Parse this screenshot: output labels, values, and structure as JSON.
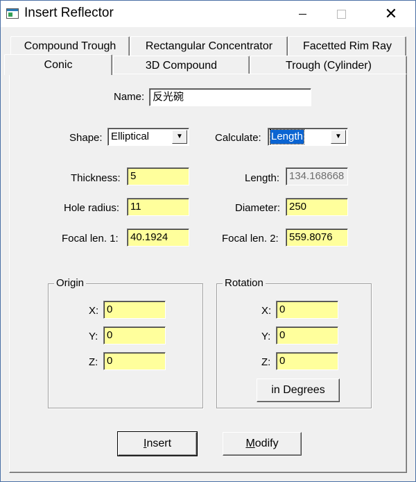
{
  "window": {
    "title": "Insert Reflector",
    "minimize": "—",
    "maximize": "☐",
    "close": "✕"
  },
  "tabs": {
    "row1": [
      "Compound Trough",
      "Rectangular Concentrator",
      "Facetted Rim Ray"
    ],
    "row2": [
      "Conic",
      "3D Compound",
      "Trough (Cylinder)"
    ],
    "active": "Conic"
  },
  "form": {
    "name": {
      "label": "Name:",
      "value": "反光碗"
    },
    "shape": {
      "label": "Shape:",
      "value": "Elliptical"
    },
    "calculate": {
      "label": "Calculate:",
      "value": "Length"
    },
    "thickness": {
      "label": "Thickness:",
      "value": "5"
    },
    "length": {
      "label": "Length:",
      "value": "134.168668"
    },
    "hole_radius": {
      "label": "Hole radius:",
      "value": "11"
    },
    "diameter": {
      "label": "Diameter:",
      "value": "250"
    },
    "focal1": {
      "label": "Focal len. 1:",
      "value": "40.1924"
    },
    "focal2": {
      "label": "Focal len. 2:",
      "value": "559.8076"
    }
  },
  "origin": {
    "title": "Origin",
    "x": {
      "label": "X:",
      "value": "0"
    },
    "y": {
      "label": "Y:",
      "value": "0"
    },
    "z": {
      "label": "Z:",
      "value": "0"
    }
  },
  "rotation": {
    "title": "Rotation",
    "x": {
      "label": "X:",
      "value": "0"
    },
    "y": {
      "label": "Y:",
      "value": "0"
    },
    "z": {
      "label": "Z:",
      "value": "0"
    },
    "degrees_button": "in Degrees"
  },
  "buttons": {
    "insert": {
      "mnemonic": "I",
      "rest": "nsert"
    },
    "modify": {
      "mnemonic": "M",
      "rest": "odify"
    }
  },
  "colors": {
    "field_bg": "#ffff9c",
    "selection": "#0a64d2"
  }
}
